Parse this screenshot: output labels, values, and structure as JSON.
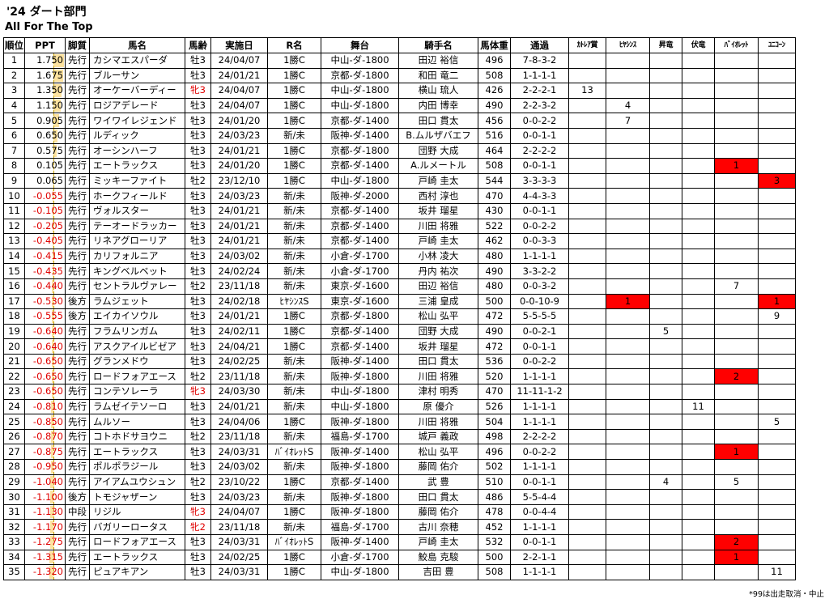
{
  "title": "'24 ダート部門",
  "subtitle": "All For The Top",
  "footnote": "*99は出走取消・中止",
  "headers": [
    "順位",
    "PPT",
    "脚質",
    "馬名",
    "馬齢",
    "実施日",
    "R名",
    "舞台",
    "騎手名",
    "馬体重",
    "通過",
    "ｶﾄﾚｱ賞",
    "ﾋﾔｼﾝｽ",
    "昇竜",
    "伏竜",
    "ﾊﾞｲｵﾚｯﾄ",
    "ﾕﾆｺｰﾝ"
  ],
  "rows": [
    {
      "rank": "1",
      "ppt": "1.750",
      "style": "先行",
      "horse": "カシマエスパーダ",
      "age": "牡3",
      "date": "24/04/07",
      "race": "1勝C",
      "venue": "中山-ダ-1800",
      "jockey": "田辺 裕信",
      "weight": "496",
      "pass": "7-8-3-2",
      "c1": "",
      "c2": "",
      "c3": "",
      "c4": "",
      "c5": "",
      "c6": ""
    },
    {
      "rank": "2",
      "ppt": "1.675",
      "style": "先行",
      "horse": "ブルーサン",
      "age": "牡3",
      "date": "24/01/21",
      "race": "1勝C",
      "venue": "京都-ダ-1800",
      "jockey": "和田 竜二",
      "weight": "508",
      "pass": "1-1-1-1",
      "c1": "",
      "c2": "",
      "c3": "",
      "c4": "",
      "c5": "",
      "c6": ""
    },
    {
      "rank": "3",
      "ppt": "1.350",
      "style": "先行",
      "horse": "オーケーバーディー",
      "age": "牝3",
      "date": "24/04/07",
      "race": "1勝C",
      "venue": "中山-ダ-1800",
      "jockey": "横山 琉人",
      "weight": "426",
      "pass": "2-2-2-1",
      "c1": "13",
      "c2": "",
      "c3": "",
      "c4": "",
      "c5": "",
      "c6": ""
    },
    {
      "rank": "4",
      "ppt": "1.150",
      "style": "先行",
      "horse": "ロジアデレード",
      "age": "牡3",
      "date": "24/04/07",
      "race": "1勝C",
      "venue": "中山-ダ-1800",
      "jockey": "内田 博幸",
      "weight": "490",
      "pass": "2-2-3-2",
      "c1": "",
      "c2": "4",
      "c3": "",
      "c4": "",
      "c5": "",
      "c6": ""
    },
    {
      "rank": "5",
      "ppt": "0.905",
      "style": "先行",
      "horse": "ワイワイレジェンド",
      "age": "牡3",
      "date": "24/01/20",
      "race": "1勝C",
      "venue": "京都-ダ-1400",
      "jockey": "田口 貫太",
      "weight": "456",
      "pass": "0-0-2-2",
      "c1": "",
      "c2": "7",
      "c3": "",
      "c4": "",
      "c5": "",
      "c6": ""
    },
    {
      "rank": "6",
      "ppt": "0.650",
      "style": "先行",
      "horse": "ルディック",
      "age": "牡3",
      "date": "24/03/23",
      "race": "新/未",
      "venue": "阪神-ダ-1400",
      "jockey": "B.ムルザバエフ",
      "weight": "516",
      "pass": "0-0-1-1",
      "c1": "",
      "c2": "",
      "c3": "",
      "c4": "",
      "c5": "",
      "c6": ""
    },
    {
      "rank": "7",
      "ppt": "0.575",
      "style": "先行",
      "horse": "オーシンハーフ",
      "age": "牡3",
      "date": "24/01/21",
      "race": "1勝C",
      "venue": "京都-ダ-1800",
      "jockey": "団野 大成",
      "weight": "464",
      "pass": "2-2-2-2",
      "c1": "",
      "c2": "",
      "c3": "",
      "c4": "",
      "c5": "",
      "c6": ""
    },
    {
      "rank": "8",
      "ppt": "0.105",
      "style": "先行",
      "horse": "エートラックス",
      "age": "牡3",
      "date": "24/01/20",
      "race": "1勝C",
      "venue": "京都-ダ-1400",
      "jockey": "A.ルメートル",
      "weight": "508",
      "pass": "0-0-1-1",
      "c1": "",
      "c2": "",
      "c3": "",
      "c4": "",
      "c5": "1",
      "c6": ""
    },
    {
      "rank": "9",
      "ppt": "0.065",
      "style": "先行",
      "horse": "ミッキーファイト",
      "age": "牡2",
      "date": "23/12/10",
      "race": "1勝C",
      "venue": "中山-ダ-1800",
      "jockey": "戸崎 圭太",
      "weight": "544",
      "pass": "3-3-3-3",
      "c1": "",
      "c2": "",
      "c3": "",
      "c4": "",
      "c5": "",
      "c6": "3"
    },
    {
      "rank": "10",
      "ppt": "-0.055",
      "style": "先行",
      "horse": "ホークフィールド",
      "age": "牡3",
      "date": "24/03/23",
      "race": "新/未",
      "venue": "阪神-ダ-2000",
      "jockey": "西村 淳也",
      "weight": "470",
      "pass": "4-4-3-3",
      "c1": "",
      "c2": "",
      "c3": "",
      "c4": "",
      "c5": "",
      "c6": ""
    },
    {
      "rank": "11",
      "ppt": "-0.105",
      "style": "先行",
      "horse": "ヴォルスター",
      "age": "牡3",
      "date": "24/01/21",
      "race": "新/未",
      "venue": "京都-ダ-1400",
      "jockey": "坂井 瑠星",
      "weight": "430",
      "pass": "0-0-1-1",
      "c1": "",
      "c2": "",
      "c3": "",
      "c4": "",
      "c5": "",
      "c6": ""
    },
    {
      "rank": "12",
      "ppt": "-0.205",
      "style": "先行",
      "horse": "テーオードラッカー",
      "age": "牡3",
      "date": "24/01/21",
      "race": "新/未",
      "venue": "京都-ダ-1400",
      "jockey": "川田 将雅",
      "weight": "522",
      "pass": "0-0-2-2",
      "c1": "",
      "c2": "",
      "c3": "",
      "c4": "",
      "c5": "",
      "c6": ""
    },
    {
      "rank": "13",
      "ppt": "-0.405",
      "style": "先行",
      "horse": "リネアグローリア",
      "age": "牡3",
      "date": "24/01/21",
      "race": "新/未",
      "venue": "京都-ダ-1400",
      "jockey": "戸崎 圭太",
      "weight": "462",
      "pass": "0-0-3-3",
      "c1": "",
      "c2": "",
      "c3": "",
      "c4": "",
      "c5": "",
      "c6": ""
    },
    {
      "rank": "14",
      "ppt": "-0.415",
      "style": "先行",
      "horse": "カリフォルニア",
      "age": "牡3",
      "date": "24/03/02",
      "race": "新/未",
      "venue": "小倉-ダ-1700",
      "jockey": "小林 凌大",
      "weight": "480",
      "pass": "1-1-1-1",
      "c1": "",
      "c2": "",
      "c3": "",
      "c4": "",
      "c5": "",
      "c6": ""
    },
    {
      "rank": "15",
      "ppt": "-0.435",
      "style": "先行",
      "horse": "キングベルベット",
      "age": "牡3",
      "date": "24/02/24",
      "race": "新/未",
      "venue": "小倉-ダ-1700",
      "jockey": "丹内 祐次",
      "weight": "490",
      "pass": "3-3-2-2",
      "c1": "",
      "c2": "",
      "c3": "",
      "c4": "",
      "c5": "",
      "c6": ""
    },
    {
      "rank": "16",
      "ppt": "-0.440",
      "style": "先行",
      "horse": "セントラルヴァレー",
      "age": "牡2",
      "date": "23/11/18",
      "race": "新/未",
      "venue": "東京-ダ-1600",
      "jockey": "田辺 裕信",
      "weight": "480",
      "pass": "0-0-3-2",
      "c1": "",
      "c2": "",
      "c3": "",
      "c4": "",
      "c5": "7",
      "c6": ""
    },
    {
      "rank": "17",
      "ppt": "-0.530",
      "style": "後方",
      "horse": "ラムジェット",
      "age": "牡3",
      "date": "24/02/18",
      "race": "ﾋﾔｼﾝｽS",
      "venue": "東京-ダ-1600",
      "jockey": "三浦 皇成",
      "weight": "500",
      "pass": "0-0-10-9",
      "c1": "",
      "c2": "1",
      "c3": "",
      "c4": "",
      "c5": "",
      "c6": "1"
    },
    {
      "rank": "18",
      "ppt": "-0.555",
      "style": "後方",
      "horse": "エイカイソウル",
      "age": "牡3",
      "date": "24/01/21",
      "race": "1勝C",
      "venue": "京都-ダ-1800",
      "jockey": "松山 弘平",
      "weight": "472",
      "pass": "5-5-5-5",
      "c1": "",
      "c2": "",
      "c3": "",
      "c4": "",
      "c5": "",
      "c6": "9"
    },
    {
      "rank": "19",
      "ppt": "-0.640",
      "style": "先行",
      "horse": "フラムリンガム",
      "age": "牡3",
      "date": "24/02/11",
      "race": "1勝C",
      "venue": "京都-ダ-1400",
      "jockey": "団野 大成",
      "weight": "490",
      "pass": "0-0-2-1",
      "c1": "",
      "c2": "",
      "c3": "5",
      "c4": "",
      "c5": "",
      "c6": ""
    },
    {
      "rank": "20",
      "ppt": "-0.640",
      "style": "先行",
      "horse": "アスクアイルビゼア",
      "age": "牡3",
      "date": "24/04/21",
      "race": "1勝C",
      "venue": "京都-ダ-1400",
      "jockey": "坂井 瑠星",
      "weight": "472",
      "pass": "0-0-1-1",
      "c1": "",
      "c2": "",
      "c3": "",
      "c4": "",
      "c5": "",
      "c6": ""
    },
    {
      "rank": "21",
      "ppt": "-0.650",
      "style": "先行",
      "horse": "グランメドウ",
      "age": "牡3",
      "date": "24/02/25",
      "race": "新/未",
      "venue": "阪神-ダ-1400",
      "jockey": "田口 貫太",
      "weight": "536",
      "pass": "0-0-2-2",
      "c1": "",
      "c2": "",
      "c3": "",
      "c4": "",
      "c5": "",
      "c6": ""
    },
    {
      "rank": "22",
      "ppt": "-0.650",
      "style": "先行",
      "horse": "ロードフォアエース",
      "age": "牡2",
      "date": "23/11/18",
      "race": "新/未",
      "venue": "阪神-ダ-1800",
      "jockey": "川田 将雅",
      "weight": "520",
      "pass": "1-1-1-1",
      "c1": "",
      "c2": "",
      "c3": "",
      "c4": "",
      "c5": "2",
      "c6": ""
    },
    {
      "rank": "23",
      "ppt": "-0.650",
      "style": "先行",
      "horse": "コンテソレーラ",
      "age": "牝3",
      "date": "24/03/30",
      "race": "新/未",
      "venue": "中山-ダ-1800",
      "jockey": "津村 明秀",
      "weight": "470",
      "pass": "11-11-1-2",
      "c1": "",
      "c2": "",
      "c3": "",
      "c4": "",
      "c5": "",
      "c6": ""
    },
    {
      "rank": "24",
      "ppt": "-0.810",
      "style": "先行",
      "horse": "ラムゼイテソーロ",
      "age": "牡3",
      "date": "24/01/21",
      "race": "新/未",
      "venue": "中山-ダ-1800",
      "jockey": "原 優介",
      "weight": "526",
      "pass": "1-1-1-1",
      "c1": "",
      "c2": "",
      "c3": "",
      "c4": "11",
      "c5": "",
      "c6": ""
    },
    {
      "rank": "25",
      "ppt": "-0.850",
      "style": "先行",
      "horse": "ムルソー",
      "age": "牡3",
      "date": "24/04/06",
      "race": "1勝C",
      "venue": "阪神-ダ-1800",
      "jockey": "川田 将雅",
      "weight": "504",
      "pass": "1-1-1-1",
      "c1": "",
      "c2": "",
      "c3": "",
      "c4": "",
      "c5": "",
      "c6": "5"
    },
    {
      "rank": "26",
      "ppt": "-0.870",
      "style": "先行",
      "horse": "コトホドサヨウニ",
      "age": "牡2",
      "date": "23/11/18",
      "race": "新/未",
      "venue": "福島-ダ-1700",
      "jockey": "城戸 義政",
      "weight": "498",
      "pass": "2-2-2-2",
      "c1": "",
      "c2": "",
      "c3": "",
      "c4": "",
      "c5": "",
      "c6": ""
    },
    {
      "rank": "27",
      "ppt": "-0.875",
      "style": "先行",
      "horse": "エートラックス",
      "age": "牡3",
      "date": "24/03/31",
      "race": "ﾊﾞｲｵﾚｯﾄS",
      "venue": "阪神-ダ-1400",
      "jockey": "松山 弘平",
      "weight": "496",
      "pass": "0-0-2-2",
      "c1": "",
      "c2": "",
      "c3": "",
      "c4": "",
      "c5": "1",
      "c6": ""
    },
    {
      "rank": "28",
      "ppt": "-0.950",
      "style": "先行",
      "horse": "ポルポラジール",
      "age": "牡3",
      "date": "24/03/02",
      "race": "新/未",
      "venue": "阪神-ダ-1800",
      "jockey": "藤岡 佑介",
      "weight": "502",
      "pass": "1-1-1-1",
      "c1": "",
      "c2": "",
      "c3": "",
      "c4": "",
      "c5": "",
      "c6": ""
    },
    {
      "rank": "29",
      "ppt": "-1.040",
      "style": "先行",
      "horse": "アイアムユウシュン",
      "age": "牡2",
      "date": "23/10/22",
      "race": "1勝C",
      "venue": "京都-ダ-1400",
      "jockey": "武 豊",
      "weight": "510",
      "pass": "0-0-1-1",
      "c1": "",
      "c2": "",
      "c3": "4",
      "c4": "",
      "c5": "5",
      "c6": ""
    },
    {
      "rank": "30",
      "ppt": "-1.100",
      "style": "後方",
      "horse": "トモジャザーン",
      "age": "牡3",
      "date": "24/03/23",
      "race": "新/未",
      "venue": "阪神-ダ-1800",
      "jockey": "田口 貫太",
      "weight": "486",
      "pass": "5-5-4-4",
      "c1": "",
      "c2": "",
      "c3": "",
      "c4": "",
      "c5": "",
      "c6": ""
    },
    {
      "rank": "31",
      "ppt": "-1.130",
      "style": "中段",
      "horse": "リジル",
      "age": "牝3",
      "date": "24/04/07",
      "race": "1勝C",
      "venue": "阪神-ダ-1800",
      "jockey": "藤岡 佑介",
      "weight": "478",
      "pass": "0-0-4-4",
      "c1": "",
      "c2": "",
      "c3": "",
      "c4": "",
      "c5": "",
      "c6": ""
    },
    {
      "rank": "32",
      "ppt": "-1.170",
      "style": "先行",
      "horse": "バガリーロータス",
      "age": "牝2",
      "date": "23/11/18",
      "race": "新/未",
      "venue": "福島-ダ-1700",
      "jockey": "古川 奈穂",
      "weight": "452",
      "pass": "1-1-1-1",
      "c1": "",
      "c2": "",
      "c3": "",
      "c4": "",
      "c5": "",
      "c6": ""
    },
    {
      "rank": "33",
      "ppt": "-1.275",
      "style": "先行",
      "horse": "ロードフォアエース",
      "age": "牡3",
      "date": "24/03/31",
      "race": "ﾊﾞｲｵﾚｯﾄS",
      "venue": "阪神-ダ-1400",
      "jockey": "戸崎 圭太",
      "weight": "532",
      "pass": "0-0-1-1",
      "c1": "",
      "c2": "",
      "c3": "",
      "c4": "",
      "c5": "2",
      "c6": ""
    },
    {
      "rank": "34",
      "ppt": "-1.315",
      "style": "先行",
      "horse": "エートラックス",
      "age": "牡3",
      "date": "24/02/25",
      "race": "1勝C",
      "venue": "小倉-ダ-1700",
      "jockey": "鮫島 克駿",
      "weight": "500",
      "pass": "2-2-1-1",
      "c1": "",
      "c2": "",
      "c3": "",
      "c4": "",
      "c5": "1",
      "c6": ""
    },
    {
      "rank": "35",
      "ppt": "-1.320",
      "style": "先行",
      "horse": "ピュアキアン",
      "age": "牡3",
      "date": "24/03/31",
      "race": "1勝C",
      "venue": "中山-ダ-1800",
      "jockey": "吉田 豊",
      "weight": "508",
      "pass": "1-1-1-1",
      "c1": "",
      "c2": "",
      "c3": "",
      "c4": "",
      "c5": "",
      "c6": "11"
    }
  ],
  "highlight": {
    "red_fill": "#ff0000",
    "red_text": "#e00000",
    "bar_fill": "#fde3a0"
  },
  "highlighted_cells": [
    {
      "rank": "8",
      "col": "c5"
    },
    {
      "rank": "9",
      "col": "c6"
    },
    {
      "rank": "17",
      "col": "c2"
    },
    {
      "rank": "17",
      "col": "c6"
    },
    {
      "rank": "22",
      "col": "c5"
    },
    {
      "rank": "27",
      "col": "c5"
    },
    {
      "rank": "33",
      "col": "c5"
    },
    {
      "rank": "34",
      "col": "c5"
    }
  ]
}
